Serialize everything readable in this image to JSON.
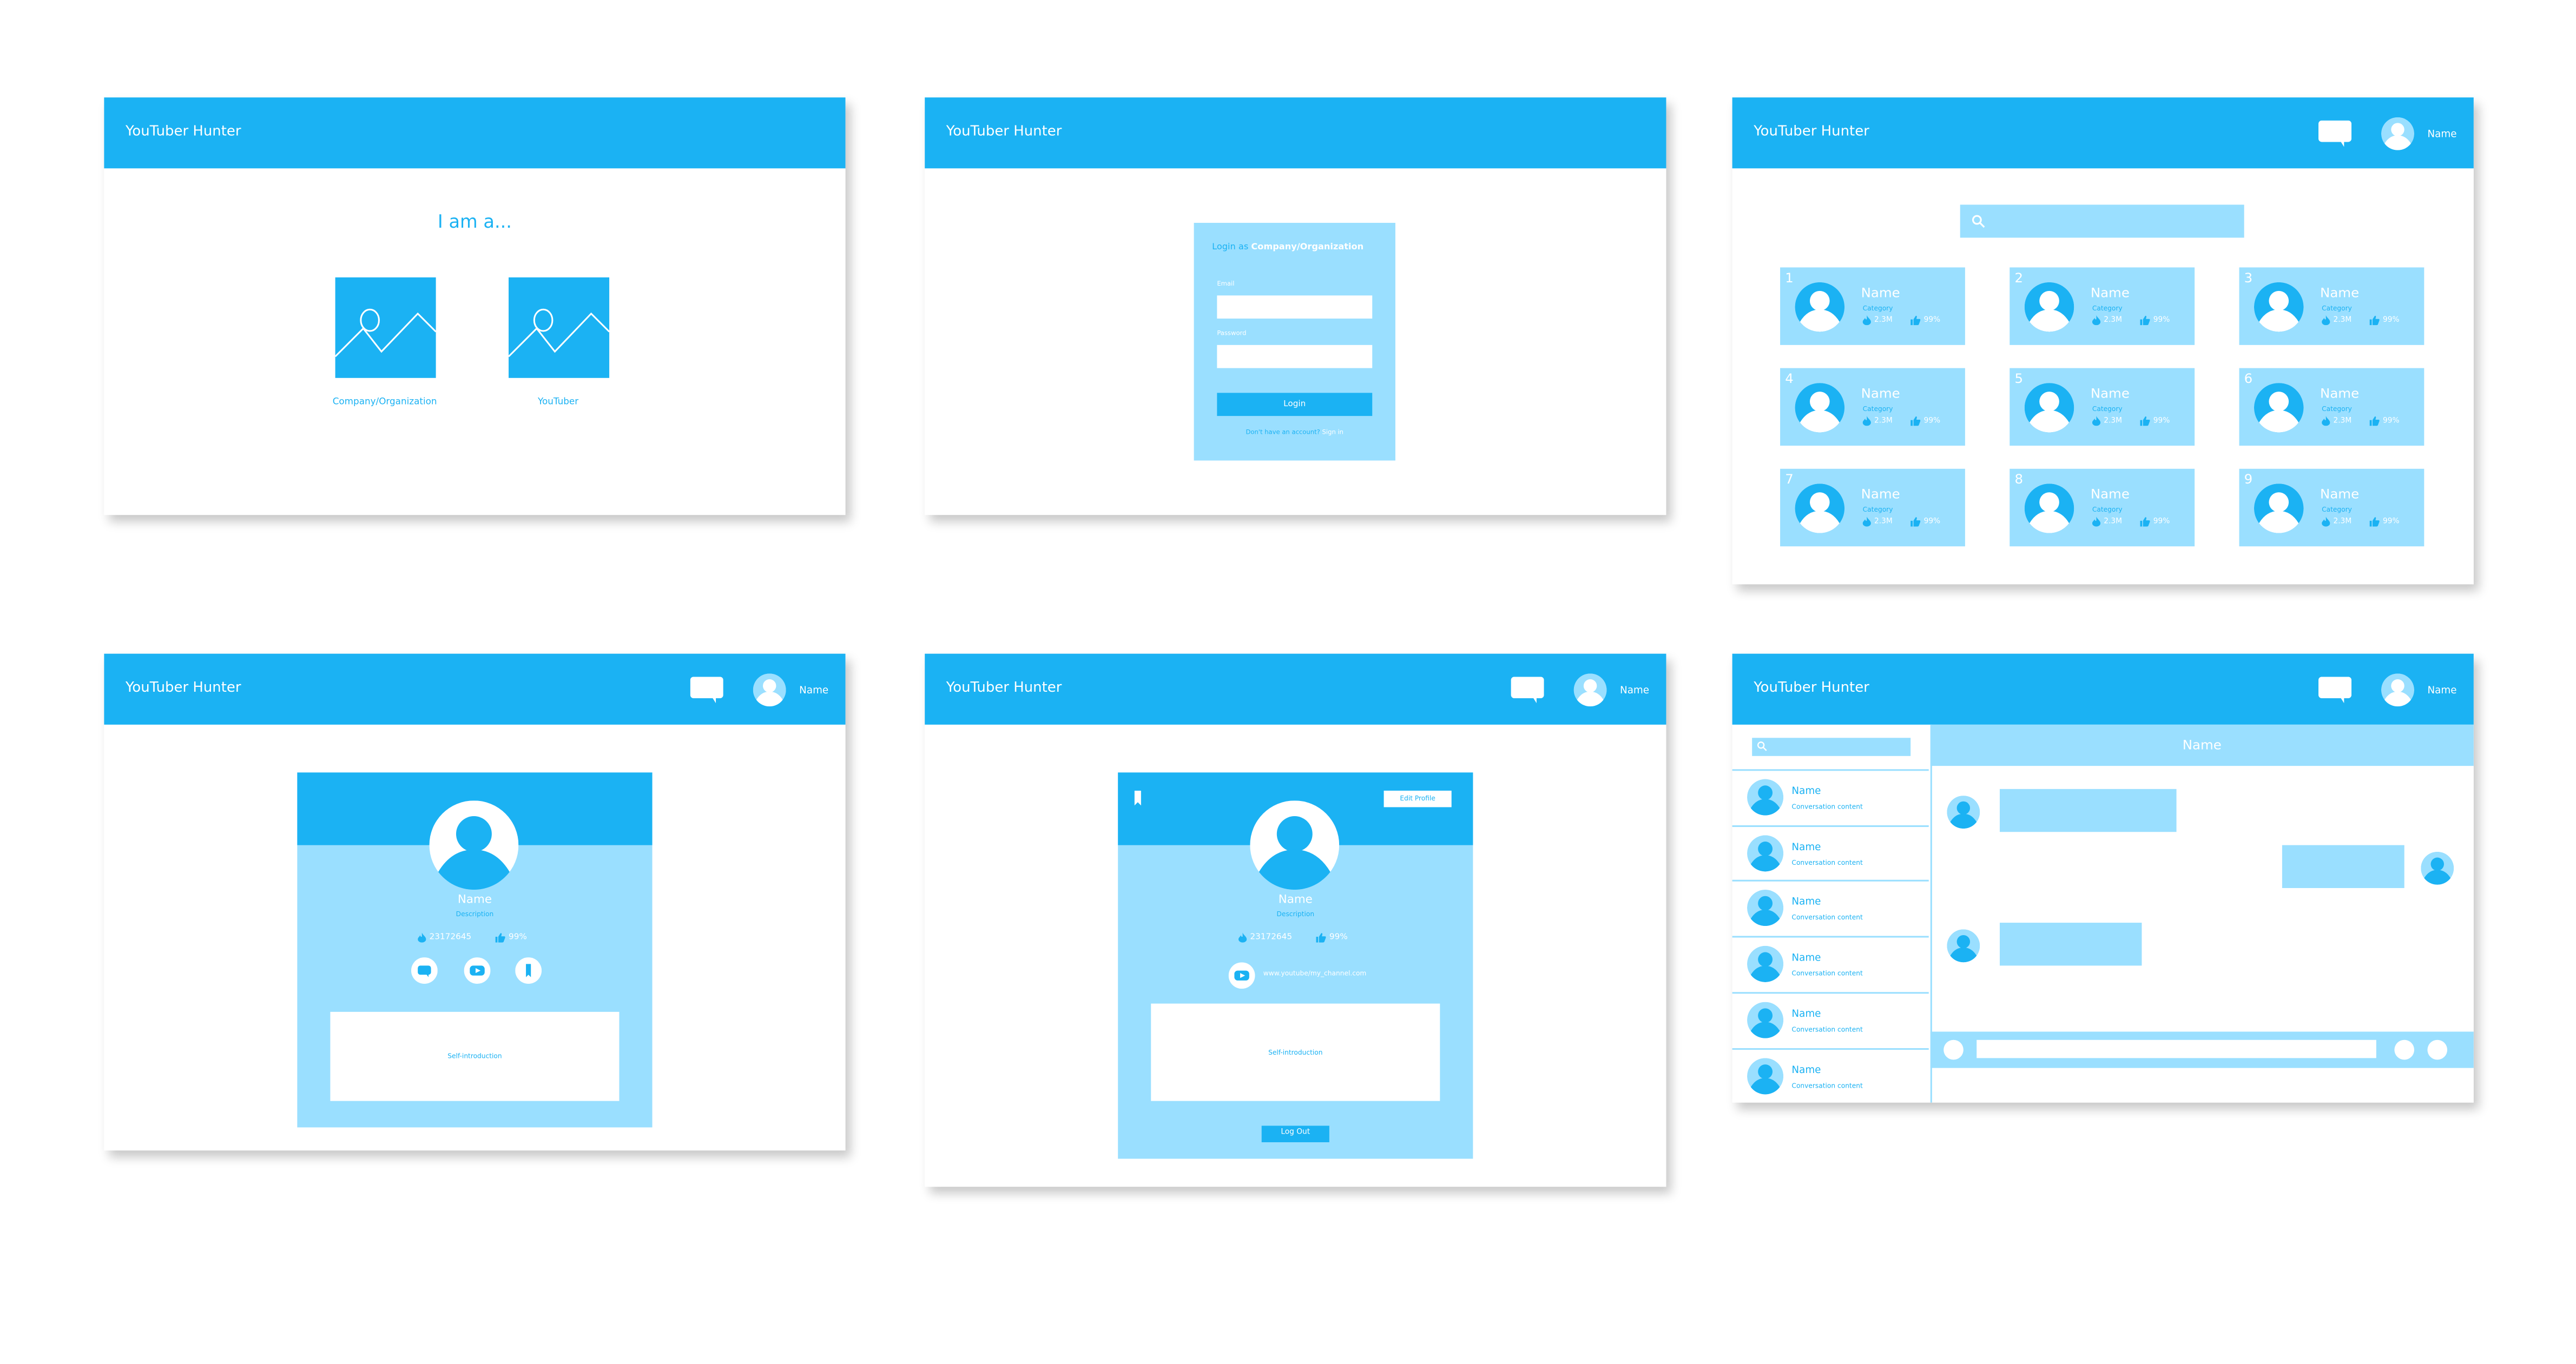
{
  "colors": {
    "primary": "#1bb2f3",
    "light": "#9adfff",
    "white": "#ffffff"
  },
  "app_title": "YouTuber Hunter",
  "header_user": {
    "name": "Name",
    "chat_icon": "chat-bubble-icon",
    "avatar_icon": "user-avatar-icon"
  },
  "role_select": {
    "heading": "I am a...",
    "options": [
      {
        "label": "Company/Organization",
        "icon": "image-placeholder-icon"
      },
      {
        "label": "YouTuber",
        "icon": "image-placeholder-icon"
      }
    ]
  },
  "login": {
    "title_prefix": "Login as",
    "title_role": "Company/Organization",
    "email_label": "Email",
    "email_value": "",
    "password_label": "Password",
    "password_value": "",
    "login_button": "Login",
    "signup_prompt": "Don't have an account?",
    "signup_link": "Sign in"
  },
  "ranking": {
    "search_placeholder": "",
    "search_icon": "search-icon",
    "cards": [
      {
        "rank": "1",
        "name": "Name",
        "category": "Category",
        "views": "2.3M",
        "likes": "99%"
      },
      {
        "rank": "2",
        "name": "Name",
        "category": "Category",
        "views": "2.3M",
        "likes": "99%"
      },
      {
        "rank": "3",
        "name": "Name",
        "category": "Category",
        "views": "2.3M",
        "likes": "99%"
      },
      {
        "rank": "4",
        "name": "Name",
        "category": "Category",
        "views": "2.3M",
        "likes": "99%"
      },
      {
        "rank": "5",
        "name": "Name",
        "category": "Category",
        "views": "2.3M",
        "likes": "99%"
      },
      {
        "rank": "6",
        "name": "Name",
        "category": "Category",
        "views": "2.3M",
        "likes": "99%"
      },
      {
        "rank": "7",
        "name": "Name",
        "category": "Category",
        "views": "2.3M",
        "likes": "99%"
      },
      {
        "rank": "8",
        "name": "Name",
        "category": "Category",
        "views": "2.3M",
        "likes": "99%"
      },
      {
        "rank": "9",
        "name": "Name",
        "category": "Category",
        "views": "2.3M",
        "likes": "99%"
      }
    ]
  },
  "profile_view": {
    "name": "Name",
    "description": "Description",
    "views": "23172645",
    "likes": "99%",
    "actions": [
      "chat-icon",
      "youtube-icon",
      "bookmark-icon"
    ],
    "intro": "Self-introduction"
  },
  "profile_own": {
    "name": "Name",
    "description": "Description",
    "views": "23172645",
    "likes": "99%",
    "edit_button": "Edit Profile",
    "channel_url": "www.youtube/my_channel.com",
    "intro": "Self-introduction",
    "logout_button": "Log Out"
  },
  "chat": {
    "search_placeholder": "",
    "conversations": [
      {
        "name": "Name",
        "preview": "Conversation content"
      },
      {
        "name": "Name",
        "preview": "Conversation content"
      },
      {
        "name": "Name",
        "preview": "Conversation content"
      },
      {
        "name": "Name",
        "preview": "Conversation content"
      },
      {
        "name": "Name",
        "preview": "Conversation content"
      },
      {
        "name": "Name",
        "preview": "Conversation content"
      }
    ],
    "active_name": "Name",
    "messages": [
      {
        "side": "left"
      },
      {
        "side": "right"
      },
      {
        "side": "left"
      }
    ],
    "message_input": ""
  }
}
